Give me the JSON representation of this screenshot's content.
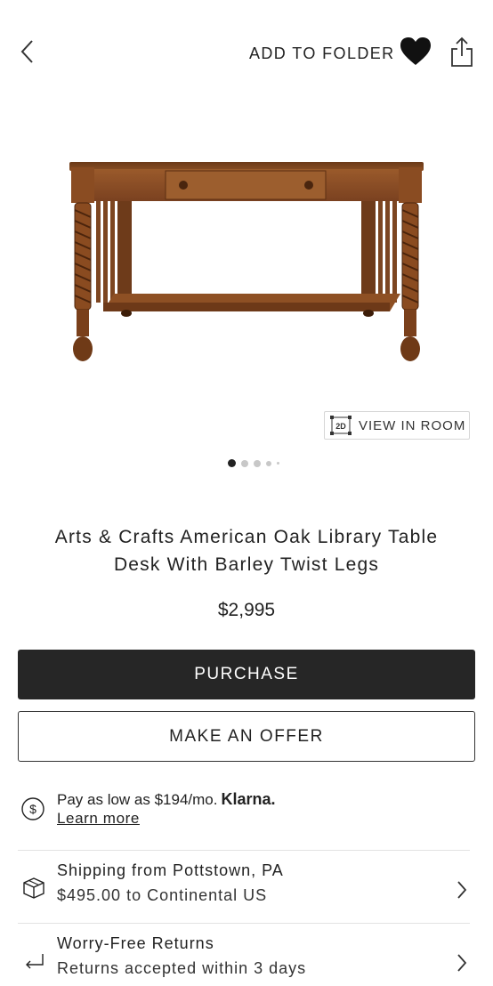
{
  "header": {
    "add_to_folder_label": "ADD TO FOLDER",
    "icons": [
      "back-chevron-icon",
      "heart-icon",
      "share-icon"
    ]
  },
  "gallery": {
    "image_subject": "oak library table with barley twist legs",
    "view_in_room_badge": "2D",
    "view_in_room_label": "VIEW IN ROOM",
    "active_slide": 1,
    "slide_count": 5
  },
  "product": {
    "title_line1": "Arts & Crafts American Oak Library Table",
    "title_line2": "Desk With Barley Twist Legs",
    "price": "$2,995"
  },
  "actions": {
    "purchase_label": "PURCHASE",
    "offer_label": "MAKE AN OFFER"
  },
  "financing": {
    "text": "Pay as low as $194/mo.",
    "brand": "Klarna.",
    "learn_more": "Learn more"
  },
  "shipping": {
    "title": "Shipping from Pottstown, PA",
    "detail": "$495.00 to Continental US"
  },
  "returns": {
    "title": "Worry-Free Returns",
    "detail": "Returns accepted within 3 days"
  },
  "colors": {
    "primary_button_bg": "#262626",
    "text": "#222222",
    "divider": "#e2e2e2",
    "wood": "#8a4f25"
  }
}
